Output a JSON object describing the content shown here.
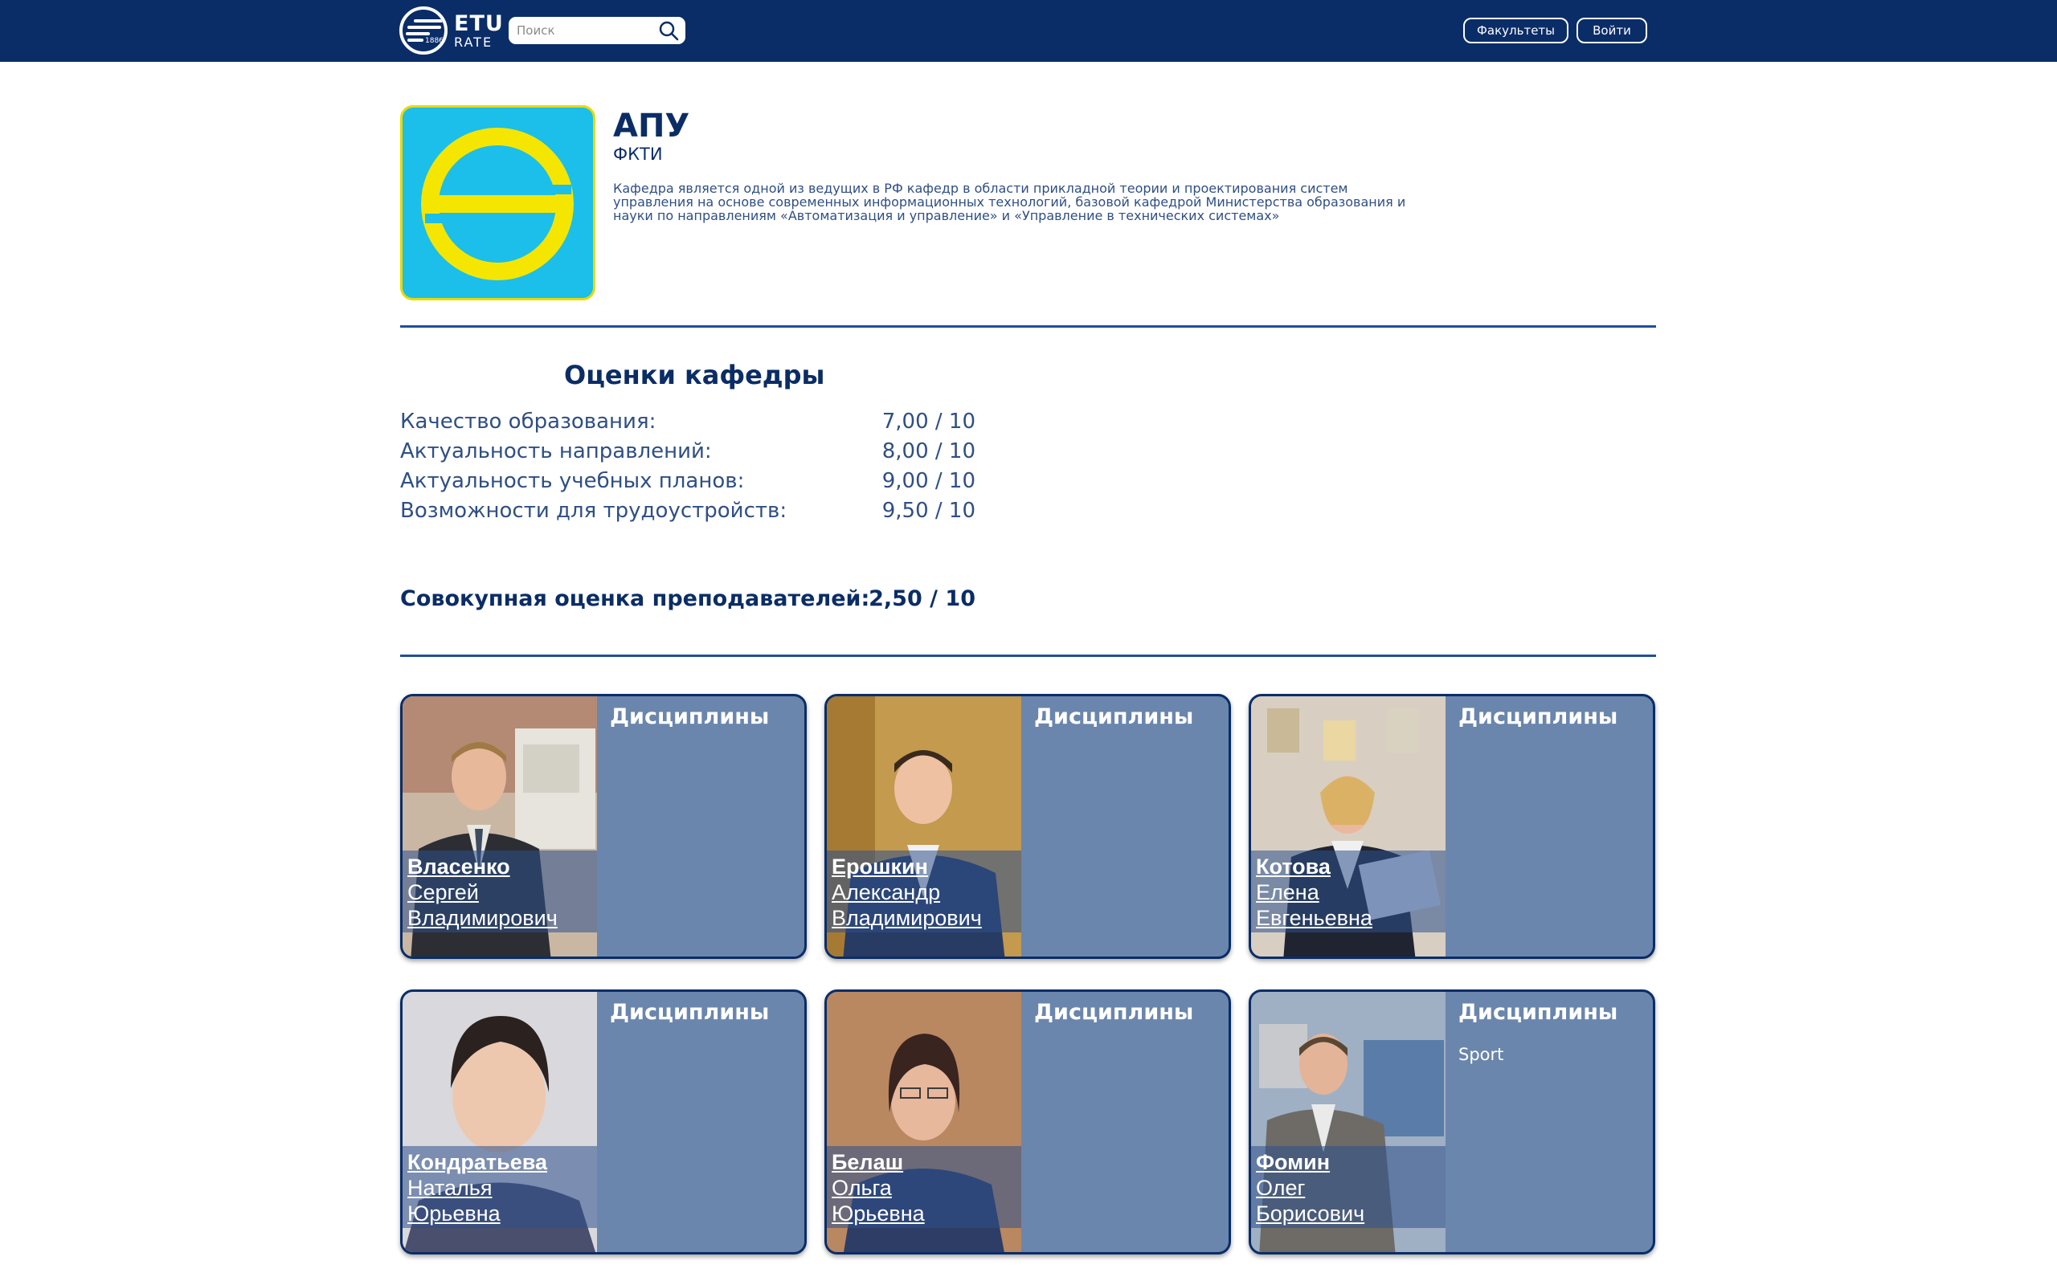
{
  "header": {
    "logo": {
      "line1": "ETU",
      "line2": "RATE",
      "year": "1886"
    },
    "search": {
      "placeholder": "Поиск"
    },
    "buttons": {
      "faculties": "Факультеты",
      "login": "Войти"
    }
  },
  "department": {
    "title": "АПУ",
    "faculty": "ФКТИ",
    "description": "Кафедра является одной из ведущих в РФ кафедр в области прикладной теории и проектирования систем управления на основе современных информационных технологий, базовой кафедрой Министерства образования и науки по направлениям «Автоматизация и управление» и «Управление в технических системах»",
    "logo_colors": {
      "background": "#1bbfe9",
      "ring": "#f4e600",
      "border": "#e9d900"
    }
  },
  "ratings": {
    "title": "Оценки кафедры",
    "items": [
      {
        "label": "Качество образования:",
        "value": "7,00 / 10"
      },
      {
        "label": "Актуальность направлений:",
        "value": "8,00 / 10"
      },
      {
        "label": "Актуальность учебных планов:",
        "value": "9,00 / 10"
      },
      {
        "label": "Возможности для трудоустройств:",
        "value": "9,50 / 10"
      }
    ],
    "aggregate": {
      "label": "Совокупная оценка преподавателей:",
      "value": "2,50 / 10"
    }
  },
  "teachers": [
    {
      "surname": "Власенко",
      "name": "Сергей",
      "patronymic": "Владимирович",
      "disciplines_title": "Дисциплины",
      "disciplines": []
    },
    {
      "surname": "Ерошкин",
      "name": "Александр",
      "patronymic": "Владимирович",
      "disciplines_title": "Дисциплины",
      "disciplines": []
    },
    {
      "surname": "Котова",
      "name": "Елена",
      "patronymic": "Евгеньевна",
      "disciplines_title": "Дисциплины",
      "disciplines": []
    },
    {
      "surname": "Кондратьева",
      "name": "Наталья",
      "patronymic": "Юрьевна",
      "disciplines_title": "Дисциплины",
      "disciplines": []
    },
    {
      "surname": "Белаш",
      "name": "Ольга",
      "patronymic": "Юрьевна",
      "disciplines_title": "Дисциплины",
      "disciplines": []
    },
    {
      "surname": "Фомин",
      "name": "Олег",
      "patronymic": "Борисович",
      "disciplines_title": "Дисциплины",
      "disciplines": [
        "Sport"
      ]
    }
  ],
  "colors": {
    "topbar": "#0a2d68",
    "card_bg": "#6b86ad",
    "text_dark": "#0b2d66",
    "text_muted": "#2f4f85"
  }
}
